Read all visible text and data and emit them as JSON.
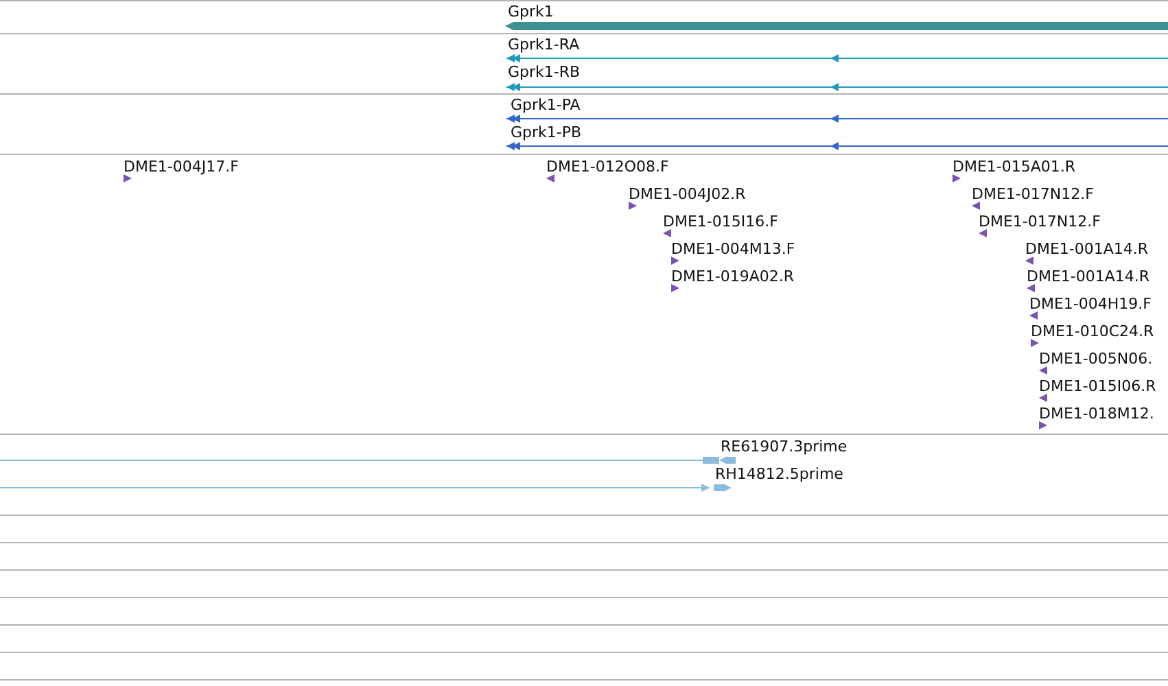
{
  "tracks": [
    {
      "kind": "gene",
      "features": [
        {
          "label": "Gprk1",
          "reverse": true
        }
      ]
    },
    {
      "kind": "transcript",
      "features": [
        {
          "label": "Gprk1-RA",
          "reverse": true
        },
        {
          "label": "Gprk1-RB",
          "reverse": true
        }
      ]
    },
    {
      "kind": "protein",
      "features": [
        {
          "label": "Gprk1-PA",
          "reverse": true
        },
        {
          "label": "Gprk1-PB",
          "reverse": true
        }
      ]
    },
    {
      "kind": "clone",
      "features": [
        {
          "label": "DME1-004J17.F",
          "reverse": false
        },
        {
          "label": "DME1-012O08.F",
          "reverse": true
        },
        {
          "label": "DME1-004J02.R",
          "reverse": false
        },
        {
          "label": "DME1-015I16.F",
          "reverse": true
        },
        {
          "label": "DME1-004M13.F",
          "reverse": false
        },
        {
          "label": "DME1-019A02.R",
          "reverse": false
        },
        {
          "label": "DME1-015A01.R",
          "reverse": false
        },
        {
          "label": "DME1-017N12.F",
          "reverse": true
        },
        {
          "label": "DME1-017N12.F",
          "reverse": true
        },
        {
          "label": "DME1-001A14.R",
          "reverse": true
        },
        {
          "label": "DME1-001A14.R",
          "reverse": true
        },
        {
          "label": "DME1-004H19.F",
          "reverse": true
        },
        {
          "label": "DME1-010C24.R",
          "reverse": false
        },
        {
          "label": "DME1-005N06.",
          "reverse": true
        },
        {
          "label": "DME1-015I06.R",
          "reverse": true
        },
        {
          "label": "DME1-018M12.",
          "reverse": false
        }
      ]
    },
    {
      "kind": "est",
      "features": [
        {
          "label": "RE61907.3prime",
          "reverse": true
        },
        {
          "label": "RH14812.5prime",
          "reverse": false
        }
      ]
    }
  ]
}
